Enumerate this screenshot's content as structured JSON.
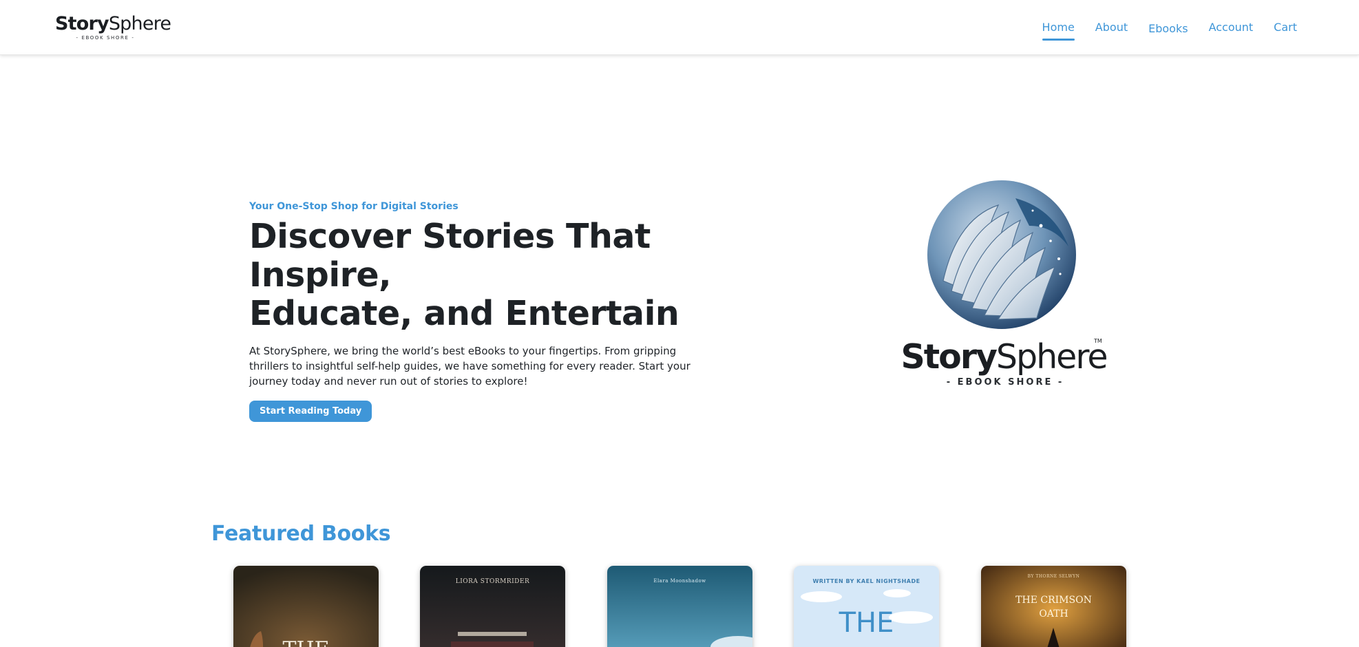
{
  "header": {
    "logo": {
      "word_bold": "Story",
      "word_regular": "Sphere",
      "tagline": "- EBOOK SHORE -"
    },
    "nav": [
      {
        "label": "Home",
        "active": true
      },
      {
        "label": "About",
        "active": false
      },
      {
        "label": "Ebooks",
        "active": false
      },
      {
        "label": "Account",
        "active": false
      },
      {
        "label": "Cart",
        "active": false
      }
    ]
  },
  "hero": {
    "eyebrow": "Your One-Stop Shop for Digital Stories",
    "title_line1": "Discover Stories That Inspire,",
    "title_line2": "Educate, and Entertain",
    "description": "At StorySphere, we bring the world’s best eBooks to your fingertips. From gripping thrillers to insightful self-help guides, we have something for every reader. Start your journey today and never run out of stories to explore!",
    "cta_label": "Start Reading Today",
    "logo": {
      "word_bold": "Story",
      "word_regular": "Sphere",
      "trademark": "TM",
      "tagline": "- EBOOK SHORE -"
    }
  },
  "featured": {
    "title": "Featured Books",
    "books": [
      {
        "author": "",
        "title": "THE"
      },
      {
        "author": "LIORA STORMRIDER",
        "title": ""
      },
      {
        "author": "Elara Moonshadow",
        "title": ""
      },
      {
        "author": "WRITTEN BY KAEL NIGHTSHADE",
        "title": "THE"
      },
      {
        "author": "BY THORNE SELWYN",
        "title": "THE CRIMSON OATH"
      }
    ]
  },
  "colors": {
    "accent": "#3f96d8",
    "heading": "#1e2226",
    "text": "#1f2328"
  }
}
